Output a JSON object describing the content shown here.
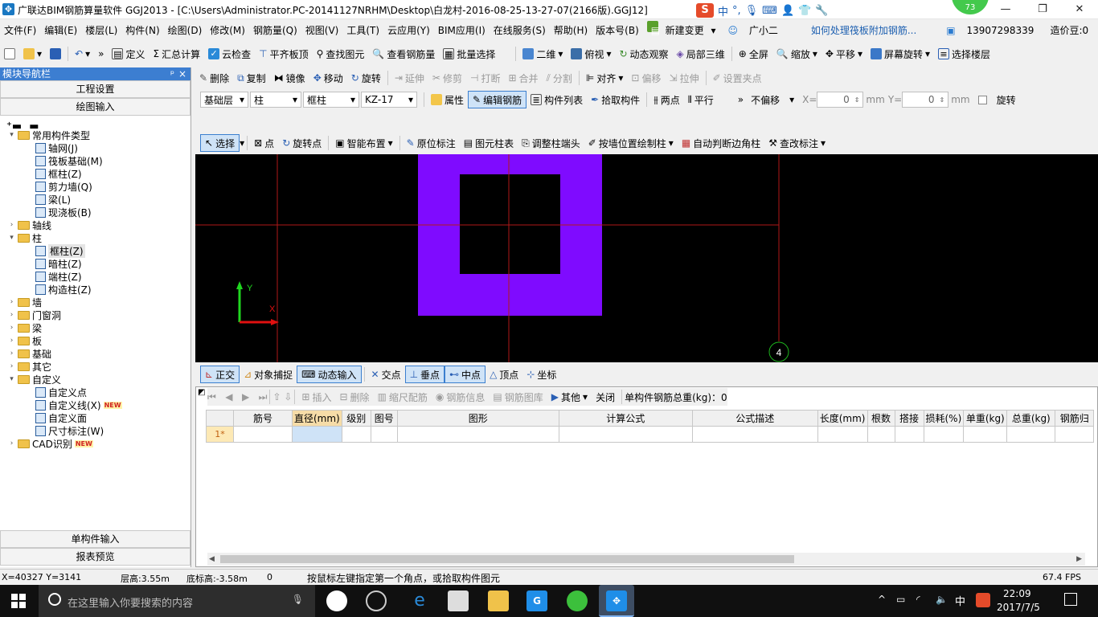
{
  "window": {
    "title": "广联达BIM钢筋算量软件 GGJ2013 - [C:\\Users\\Administrator.PC-20141127NRHM\\Desktop\\白龙村-2016-08-25-13-27-07(2166版).GGJ12]",
    "app_icon": "glodon-app-icon",
    "min": "—",
    "max": "❐",
    "close": "✕",
    "badge": "73"
  },
  "ime": {
    "logo": "S",
    "lang": "中",
    "punct": "°,",
    "items": [
      "mic-icon",
      "keyboard-icon",
      "user-icon",
      "shirt-icon",
      "wrench-icon"
    ]
  },
  "menu": [
    "文件(F)",
    "编辑(E)",
    "楼层(L)",
    "构件(N)",
    "绘图(D)",
    "修改(M)",
    "钢筋量(Q)",
    "视图(V)",
    "工具(T)",
    "云应用(Y)",
    "BIM应用(I)",
    "在线服务(S)",
    "帮助(H)",
    "版本号(B)",
    "新建变更",
    "广小二",
    "如何处理筏板附加钢筋...",
    "13907298339",
    "造价豆:0"
  ],
  "toolbar1": [
    "定义",
    "汇总计算",
    "云检查",
    "平齐板顶",
    "查找图元",
    "查看钢筋量",
    "批量选择",
    "二维",
    "俯视",
    "动态观察",
    "局部三维",
    "全屏",
    "缩放",
    "平移",
    "屏幕旋转",
    "选择楼层"
  ],
  "toolbar2": [
    "删除",
    "复制",
    "镜像",
    "移动",
    "旋转",
    "延伸",
    "修剪",
    "打断",
    "合并",
    "分割",
    "对齐",
    "偏移",
    "拉伸",
    "设置夹点"
  ],
  "toolbar3": {
    "floor": "基础层",
    "type": "柱",
    "sub": "框柱",
    "name": "KZ-17",
    "props": "属性",
    "edit_rebar": "编辑钢筋",
    "list": "构件列表",
    "pick": "拾取构件",
    "twopoint": "两点",
    "parallel": "平行",
    "offset": "不偏移",
    "x_label": "X=",
    "x": "0",
    "y_label": "Y=",
    "y": "0",
    "unit": "mm",
    "rotate": "旋转"
  },
  "toolbar4": [
    "选择",
    "点",
    "旋转点",
    "智能布置",
    "原位标注",
    "图元柱表",
    "调整柱端头",
    "按墙位置绘制柱",
    "自动判断边角柱",
    "查改标注"
  ],
  "nav": {
    "header": "模块导航栏",
    "pin": "ᵖ",
    "close": "×",
    "sections": [
      "工程设置",
      "绘图输入"
    ],
    "bottom": [
      "单构件输入",
      "报表预览"
    ],
    "tree": [
      {
        "l": "常用构件类型",
        "d": 0,
        "t": "▾",
        "f": true
      },
      {
        "l": "轴网(J)",
        "d": 1
      },
      {
        "l": "筏板基础(M)",
        "d": 1
      },
      {
        "l": "框柱(Z)",
        "d": 1
      },
      {
        "l": "剪力墙(Q)",
        "d": 1
      },
      {
        "l": "梁(L)",
        "d": 1
      },
      {
        "l": "现浇板(B)",
        "d": 1
      },
      {
        "l": "轴线",
        "d": 0,
        "t": "›",
        "f": true
      },
      {
        "l": "柱",
        "d": 0,
        "t": "▾",
        "f": true
      },
      {
        "l": "框柱(Z)",
        "d": 1,
        "sel": true
      },
      {
        "l": "暗柱(Z)",
        "d": 1
      },
      {
        "l": "端柱(Z)",
        "d": 1
      },
      {
        "l": "构造柱(Z)",
        "d": 1
      },
      {
        "l": "墙",
        "d": 0,
        "t": "›",
        "f": true
      },
      {
        "l": "门窗洞",
        "d": 0,
        "t": "›",
        "f": true
      },
      {
        "l": "梁",
        "d": 0,
        "t": "›",
        "f": true
      },
      {
        "l": "板",
        "d": 0,
        "t": "›",
        "f": true
      },
      {
        "l": "基础",
        "d": 0,
        "t": "›",
        "f": true
      },
      {
        "l": "其它",
        "d": 0,
        "t": "›",
        "f": true
      },
      {
        "l": "自定义",
        "d": 0,
        "t": "▾",
        "f": true
      },
      {
        "l": "自定义点",
        "d": 1
      },
      {
        "l": "自定义线(X)",
        "d": 1,
        "new": "NEW"
      },
      {
        "l": "自定义面",
        "d": 1
      },
      {
        "l": "尺寸标注(W)",
        "d": 1
      },
      {
        "l": "CAD识别",
        "d": 0,
        "t": "›",
        "f": true,
        "new": "NEW"
      }
    ]
  },
  "canvas": {
    "axis_y": "Y",
    "axis_x": "X",
    "grid_label": "4"
  },
  "snapbar": [
    "正交",
    "对象捕捉",
    "动态输入",
    "交点",
    "垂点",
    "中点",
    "顶点",
    "坐标"
  ],
  "grid": {
    "tools": [
      "插入",
      "删除",
      "缩尺配筋",
      "钢筋信息",
      "钢筋图库",
      "其他",
      "关闭"
    ],
    "total": "单构件钢筋总重(kg)：0",
    "headers": [
      "",
      "筋号",
      "直径(mm)",
      "级别",
      "图号",
      "图形",
      "计算公式",
      "公式描述",
      "长度(mm)",
      "根数",
      "搭接",
      "损耗(%)",
      "单重(kg)",
      "总重(kg)",
      "钢筋归"
    ],
    "row": "1*"
  },
  "status": {
    "coords": "X=40327 Y=3141",
    "floor_h": "层高:3.55m",
    "bottom_h": "底标高:-3.58m",
    "zero": "0",
    "hint": "按鼠标左键指定第一个角点，或拾取构件图元",
    "fps": "67.4 FPS"
  },
  "taskbar": {
    "search": "在这里输入你要搜索的内容",
    "time": "22:09",
    "date": "2017/7/5",
    "lang": "中"
  }
}
